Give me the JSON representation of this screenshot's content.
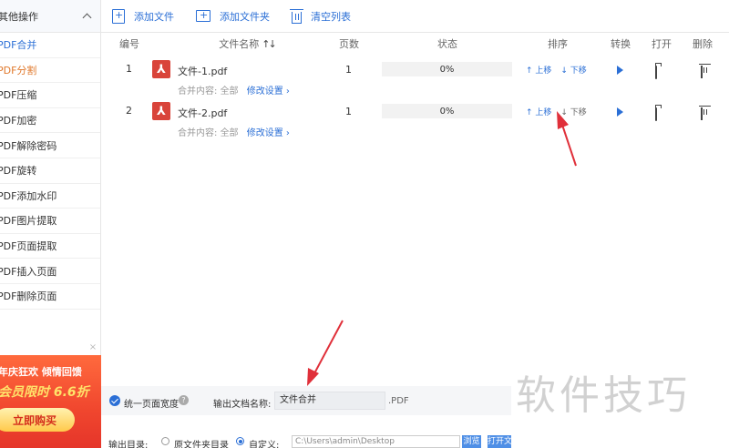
{
  "sidebar": {
    "header": "其他操作",
    "items": [
      {
        "label": "PDF合并",
        "state": "active"
      },
      {
        "label": "PDF分割",
        "state": "selected"
      },
      {
        "label": "PDF压缩",
        "state": ""
      },
      {
        "label": "PDF加密",
        "state": ""
      },
      {
        "label": "PDF解除密码",
        "state": ""
      },
      {
        "label": "PDF旋转",
        "state": ""
      },
      {
        "label": "PDF添加水印",
        "state": ""
      },
      {
        "label": "PDF图片提取",
        "state": ""
      },
      {
        "label": "PDF页面提取",
        "state": ""
      },
      {
        "label": "PDF插入页面",
        "state": ""
      },
      {
        "label": "PDF删除页面",
        "state": ""
      }
    ]
  },
  "ad": {
    "close": "×",
    "line1": "年庆狂欢 倾情回馈",
    "line2": "会员限时 6.6折",
    "button": "立即购买"
  },
  "toolbar": {
    "add_file": "添加文件",
    "add_folder": "添加文件夹",
    "clear_list": "清空列表"
  },
  "table": {
    "headers": {
      "index": "编号",
      "filename": "文件名称",
      "pages": "页数",
      "status": "状态",
      "sort": "排序",
      "convert": "转换",
      "open": "打开",
      "delete": "删除"
    },
    "rows": [
      {
        "index": "1",
        "filename": "文件-1.pdf",
        "pages": "1",
        "progress": "0%",
        "merge_label": "合并内容:",
        "merge_value": "全部",
        "edit": "修改设置 ›",
        "up": "↑ 上移",
        "down": "↓ 下移"
      },
      {
        "index": "2",
        "filename": "文件-2.pdf",
        "pages": "1",
        "progress": "0%",
        "merge_label": "合并内容:",
        "merge_value": "全部",
        "edit": "修改设置 ›",
        "up": "↑ 上移",
        "down": "↓ 下移"
      }
    ]
  },
  "settings": {
    "uniform_width": "统一页面宽度",
    "output_name_label": "输出文档名称:",
    "output_name_value": "文件合并",
    "ext": ".PDF"
  },
  "output_dir": {
    "label": "输出目录:",
    "option_original": "原文件夹目录",
    "option_custom": "自定义:",
    "path": "C:\\Users\\admin\\Desktop",
    "browse": "浏览",
    "open_folder": "打开文"
  },
  "watermark": "软件技巧",
  "colors": {
    "accent": "#2b6fd6",
    "annotation_arrow": "#e0303a",
    "pdf_icon": "#d9443a"
  }
}
